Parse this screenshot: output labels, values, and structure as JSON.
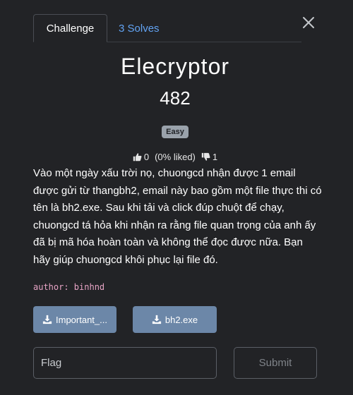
{
  "tabs": {
    "challenge_label": "Challenge",
    "solves_label": "3 Solves"
  },
  "challenge": {
    "title": "Elecryptor",
    "value": "482",
    "difficulty": "Easy",
    "likes": "0",
    "liked_percent": "(0% liked)",
    "dislikes": "1",
    "description": "Vào một ngày xấu trời nọ, chuongcd nhận được 1 email được gửi từ thangbh2, email này bao gồm một file thực thi có tên là bh2.exe. Sau khi tải và click đúp chuột để chạy, chuongcd tá hỏa khi nhận ra rằng file quan trọng của anh ấy đã bị mã hóa hoàn toàn và không thể đọc được nữa. Bạn hãy giúp chuongcd khôi phục lại file đó.",
    "author": "author: binhnd"
  },
  "files": [
    {
      "label": "Important_...",
      "icon": "download-icon"
    },
    {
      "label": "bh2.exe",
      "icon": "download-icon"
    }
  ],
  "form": {
    "flag_placeholder": "Flag",
    "submit_label": "Submit"
  },
  "icons": {
    "close": "close-icon",
    "like": "thumbs-up-icon",
    "dislike": "thumbs-down-icon"
  },
  "colors": {
    "background": "#222326",
    "link": "#62a3f3",
    "file_button": "#6c87a8",
    "badge": "#9aa2ab",
    "author": "#e7a4c5"
  }
}
